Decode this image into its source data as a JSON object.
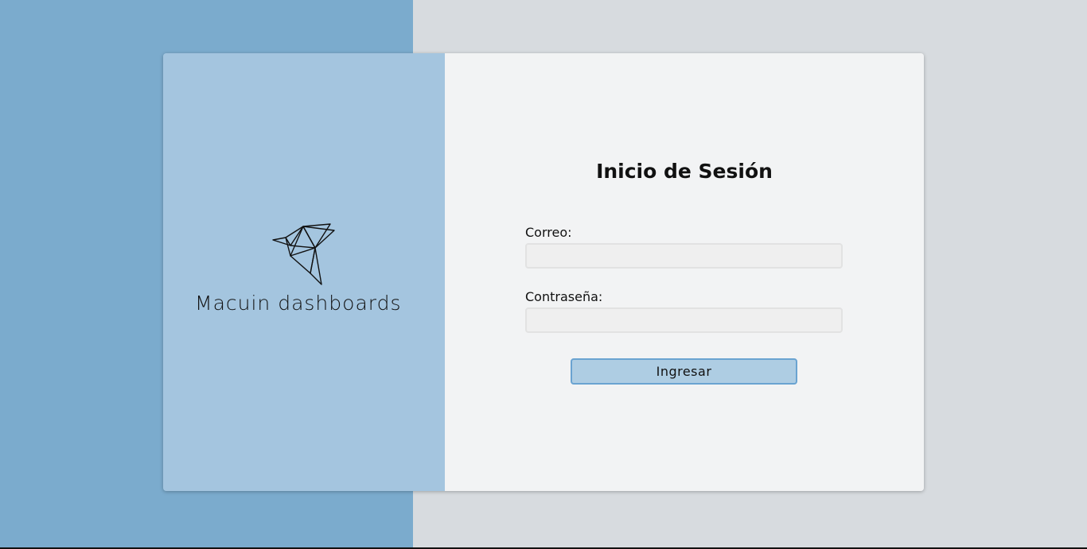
{
  "brand": {
    "name": "Macuin dashboards",
    "logo_icon": "origami-bird-icon"
  },
  "form": {
    "title": "Inicio de Sesión",
    "email_label": "Correo:",
    "email_value": "",
    "password_label": "Contraseña:",
    "password_value": "",
    "submit_label": "Ingresar"
  },
  "colors": {
    "background_left": "#7babcd",
    "background_right": "#d7dbdf",
    "brand_panel": "#a4c5df",
    "form_panel": "#f2f3f4",
    "button_fill": "#aecde3",
    "button_border": "#6aa3d1"
  }
}
